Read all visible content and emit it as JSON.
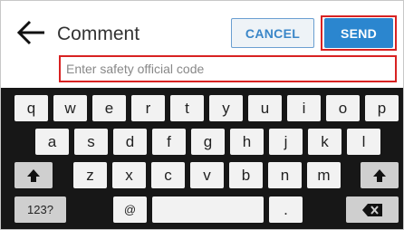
{
  "header": {
    "title": "Comment",
    "cancel_label": "CANCEL",
    "send_label": "SEND"
  },
  "input": {
    "placeholder": "Enter safety official code",
    "value": ""
  },
  "keyboard": {
    "row1": [
      "q",
      "w",
      "e",
      "r",
      "t",
      "y",
      "u",
      "i",
      "o",
      "p"
    ],
    "row2": [
      "a",
      "s",
      "d",
      "f",
      "g",
      "h",
      "j",
      "k",
      "l"
    ],
    "row3": [
      "z",
      "x",
      "c",
      "v",
      "b",
      "n",
      "m"
    ],
    "numbers_label": "123?",
    "at_label": "@",
    "period_label": "."
  },
  "colors": {
    "accent": "#2b86cf",
    "highlight": "#d82222",
    "keyboard_bg": "#171717"
  },
  "icons": {
    "back": "arrow-left-icon",
    "shift": "shift-arrow-up-icon",
    "backspace": "backspace-icon"
  }
}
